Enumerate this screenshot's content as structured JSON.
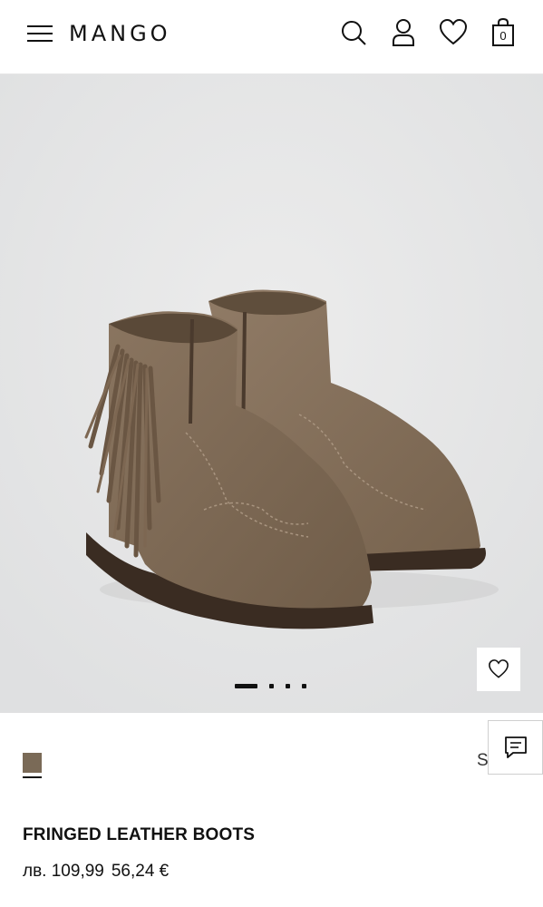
{
  "header": {
    "logo": "MANGO",
    "bag_count": "0"
  },
  "icons": {
    "menu": "hamburger-menu-icon",
    "search": "search-icon",
    "account": "user-icon",
    "wishlist": "heart-icon",
    "bag": "shopping-bag-icon",
    "chat": "chat-icon"
  },
  "gallery": {
    "image_count": 4,
    "active_index": 0
  },
  "product": {
    "color_name": "Sand",
    "color_swatch": "#7a6a57",
    "title": "FRINGED LEATHER BOOTS",
    "price_bgn": "лв. 109,99",
    "price_eur": "56,24 €"
  }
}
